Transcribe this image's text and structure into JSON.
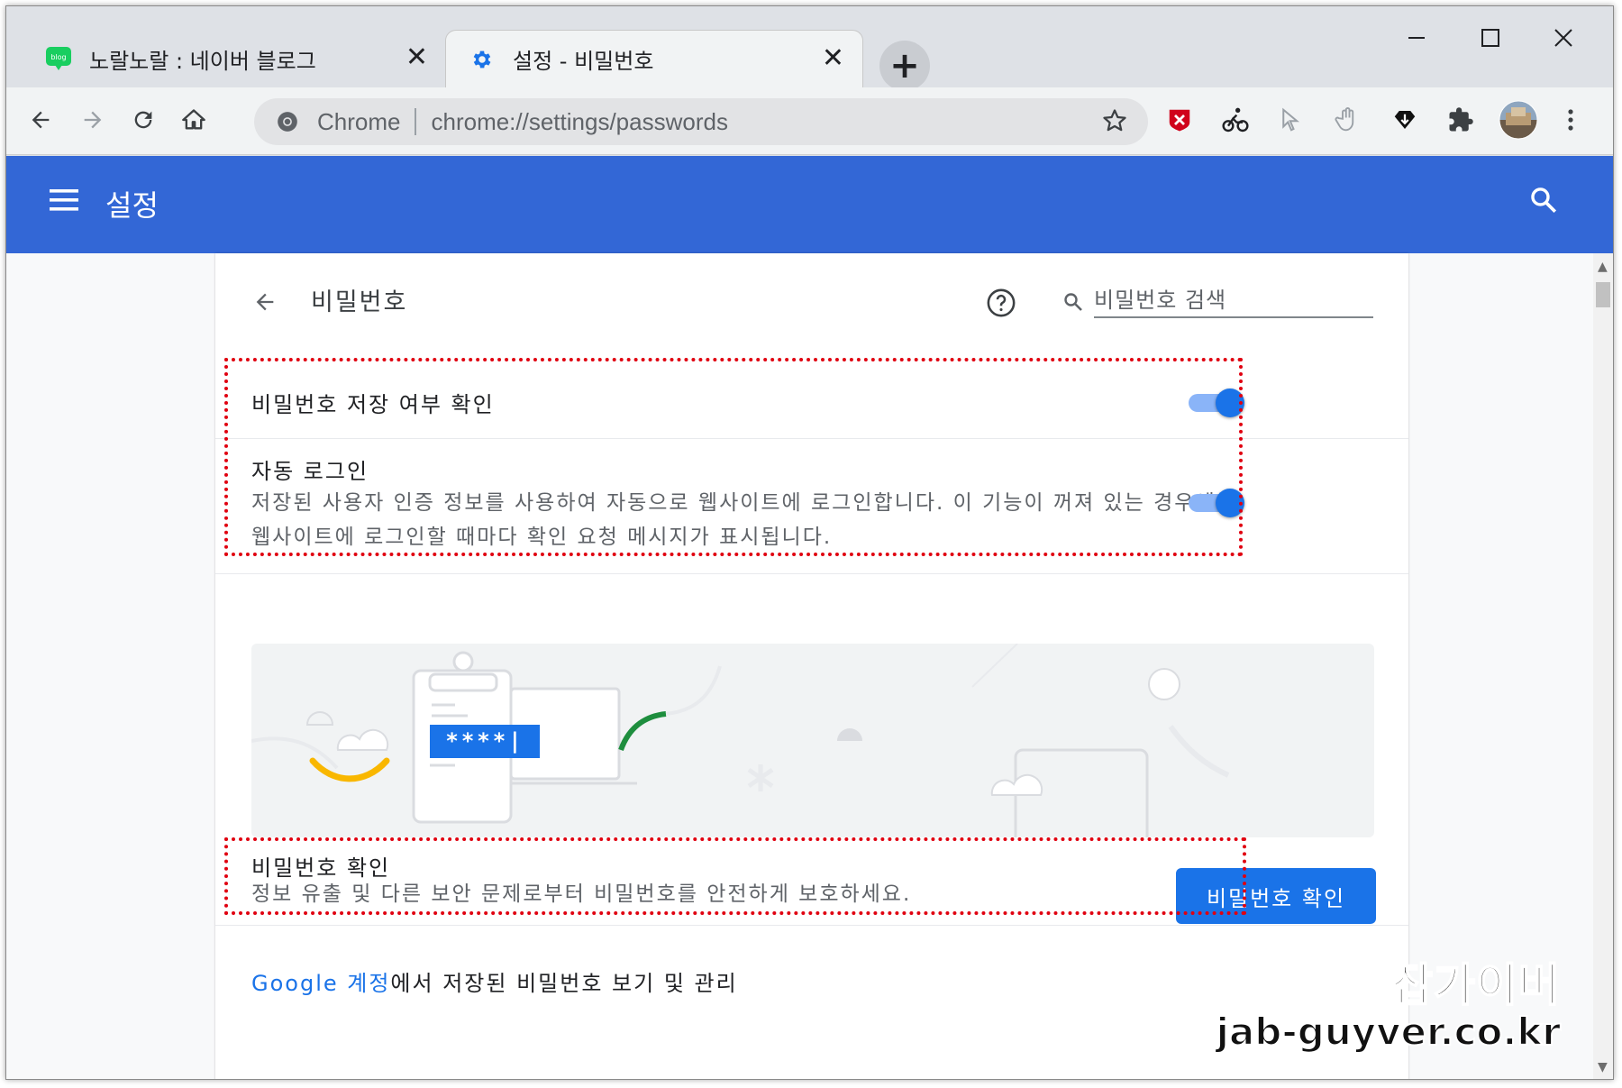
{
  "tabs": [
    {
      "title": "노랄노랄 : 네이버 블로그",
      "favicon": "naver-blog-icon",
      "favicon_text": "blog",
      "active": false
    },
    {
      "title": "설정 - 비밀번호",
      "favicon": "settings-gear-icon",
      "active": true
    }
  ],
  "omnibox": {
    "scheme_label": "Chrome",
    "url": "chrome://settings/passwords"
  },
  "app_bar": {
    "title": "설정"
  },
  "page": {
    "title": "비밀번호",
    "search_placeholder": "비밀번호 검색"
  },
  "offer_save": {
    "label": "비밀번호 저장 여부 확인",
    "enabled": true
  },
  "auto_signin": {
    "label": "자동 로그인",
    "description": "저장된 사용자 인증 정보를 사용하여 자동으로 웹사이트에 로그인합니다. 이 기능이 꺼져 있는 경우에는 웹사이트에 로그인할 때마다 확인 요청 메시지가 표시됩니다.",
    "enabled": true
  },
  "illustration": {
    "password_mask": "****|"
  },
  "check": {
    "label": "비밀번호 확인",
    "description": "정보 유출 및 다른 보안 문제로부터 비밀번호를 안전하게 보호하세요.",
    "button": "비밀번호 확인"
  },
  "google_account": {
    "link": "Google 계정",
    "rest": "에서 저장된 비밀번호 보기 및 관리"
  },
  "watermark": {
    "line1": "잡가이버",
    "line2": "jab-guyver.co.kr"
  },
  "colors": {
    "accent": "#1a73e8",
    "header": "#3367d6",
    "annotation_red": "#e00010"
  }
}
